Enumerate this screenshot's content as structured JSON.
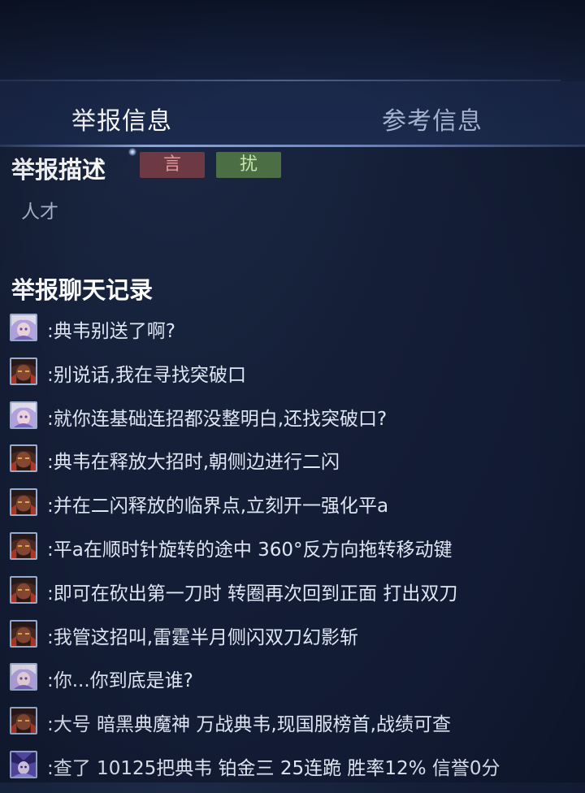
{
  "tabs": {
    "report_info": "举报信息",
    "reference_info": "参考信息"
  },
  "report": {
    "description_title": "举报描述",
    "tags": [
      {
        "label": "言",
        "color": "#6d3a44"
      },
      {
        "label": "扰",
        "color": "#4c6e45"
      }
    ],
    "description_text": "人才"
  },
  "chat": {
    "title": "举报聊天记录",
    "messages": [
      {
        "avatar": "avatar-girl-icon",
        "text": ":典韦别送了啊?"
      },
      {
        "avatar": "avatar-dianwei-icon",
        "text": ":别说话,我在寻找突破口"
      },
      {
        "avatar": "avatar-girl-icon",
        "text": ":就你连基础连招都没整明白,还找突破口?"
      },
      {
        "avatar": "avatar-dianwei-icon",
        "text": ":典韦在释放大招时,朝侧边进行二闪"
      },
      {
        "avatar": "avatar-dianwei-icon",
        "text": ":并在二闪释放的临界点,立刻开一强化平a"
      },
      {
        "avatar": "avatar-dianwei-icon",
        "text": ":平a在顺时针旋转的途中 360°反方向拖转移动键"
      },
      {
        "avatar": "avatar-dianwei-icon",
        "text": ":即可在砍出第一刀时 转圈再次回到正面 打出双刀"
      },
      {
        "avatar": "avatar-dianwei-icon",
        "text": ":我管这招叫,雷霆半月侧闪双刀幻影斩"
      },
      {
        "avatar": "avatar-girl-icon",
        "text": ":你...你到底是谁?"
      },
      {
        "avatar": "avatar-dianwei-icon",
        "text": ":大号 暗黑典魔神 万战典韦,现国服榜首,战绩可查"
      },
      {
        "avatar": "avatar-mage-icon",
        "text": ":查了 10125把典韦 铂金三 25连跪 胜率12% 信誉0分"
      }
    ]
  }
}
